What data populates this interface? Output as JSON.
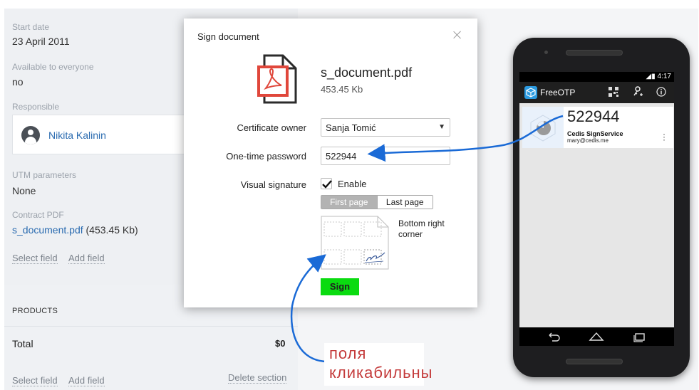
{
  "crm": {
    "start_date_label": "Start date",
    "start_date_value": "23 April 2011",
    "available_label": "Available to everyone",
    "available_value": "no",
    "responsible_label": "Responsible",
    "responsible_name": "Nikita Kalinin",
    "utm_label": "UTM parameters",
    "utm_value": "None",
    "contract_label": "Contract PDF",
    "contract_file": "s_document.pdf",
    "contract_size": " (453.45 Kb)",
    "select_field": "Select field",
    "add_field": "Add field",
    "products_label": "PRODUCTS",
    "total_label": "Total",
    "total_value": "$0",
    "delete_section": "Delete section"
  },
  "modal": {
    "title": "Sign document",
    "file_name": "s_document.pdf",
    "file_size": "453.45 Kb",
    "certificate_owner_label": "Certificate owner",
    "certificate_owner_value": "Sanja Tomić",
    "otp_label": "One-time password",
    "otp_value": "522944",
    "visual_signature_label": "Visual signature",
    "enable_label": "Enable",
    "enable_checked": true,
    "page_options": [
      "First page",
      "Last page"
    ],
    "selected_page": "First page",
    "position_label": "Bottom right corner",
    "sign_button": "Sign",
    "sign_button_color": "#0adb10"
  },
  "phone": {
    "status_time": "4:17",
    "app_title": "FreeOTP",
    "otp_code": "522944",
    "issuer": "Cedis SignService",
    "account": "mary@cedis.me",
    "appbar_icons": [
      "qr-code-icon",
      "add-key-icon",
      "info-icon"
    ],
    "nav_icons": [
      "back-icon",
      "home-icon",
      "recents-icon"
    ]
  },
  "annotation": {
    "text_line1": "поля",
    "text_line2": "кликабильны",
    "color": "#c43b3b",
    "arrow_color": "#1a6ad6"
  }
}
